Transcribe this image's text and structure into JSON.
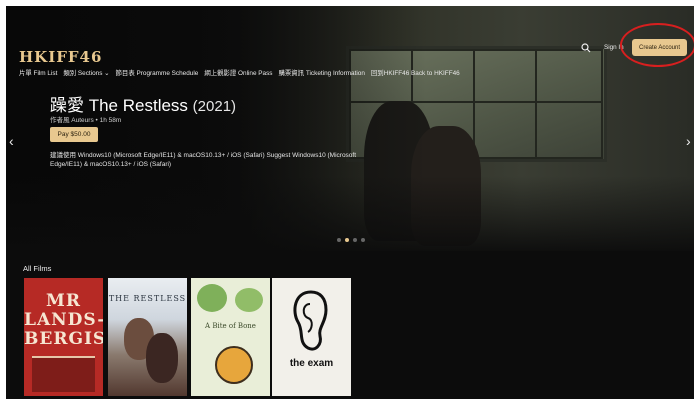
{
  "header": {
    "logo": "HKIFF46",
    "nav": [
      "片單 Film List",
      "類別 Sections ⌄",
      "節目表 Programme Schedule",
      "網上觀影證 Online Pass",
      "購票資訊 Ticketing Information",
      "回到HKIFF46 Back to HKIFF46"
    ],
    "sign_in": "Sign In",
    "create_account": "Create Account"
  },
  "hero": {
    "title": "躁愛 The Restless",
    "year": "(2021)",
    "meta": "作者風 Auteurs • 1h 58m",
    "pay_label": "Pay $50.00",
    "note": "建議使用 Windows10 (Microsoft Edge/IE11) & macOS10.13+ / iOS (Safari) Suggest Windows10 (Microsoft Edge/IE11) & macOS10.13+ / iOS (Safari)",
    "prev_arrow": "‹",
    "next_arrow": "›"
  },
  "films_section": {
    "title": "All Films",
    "posters": [
      {
        "text": "MR LANDS-BERGIS",
        "color": "#b62a25"
      },
      {
        "text": "THE RESTLESS",
        "color": "#cfd6de"
      },
      {
        "text": "A Bite of Bone",
        "color": "#e9eed8"
      },
      {
        "text": "the exam",
        "color": "#f2f0ea"
      }
    ]
  },
  "annotation": {
    "color": "#d71f1f"
  },
  "colors": {
    "accent": "#e8c88f",
    "background": "#0c0c0c"
  }
}
